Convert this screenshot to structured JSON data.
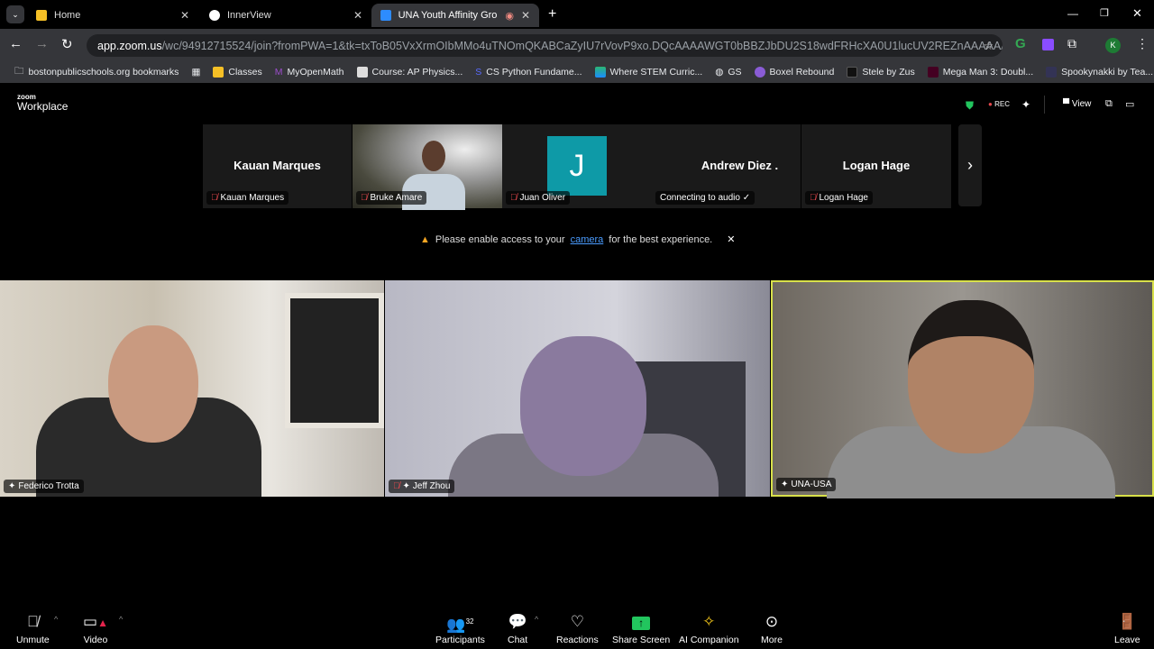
{
  "browser": {
    "tabs": [
      {
        "label": "Home",
        "active": false
      },
      {
        "label": "InnerView",
        "active": false
      },
      {
        "label": "UNA Youth Affinity Group A",
        "active": true
      }
    ],
    "url_domain": "app.zoom.us",
    "url_rest": "/wc/94912715524/join?fromPWA=1&tk=txToB05VxXrmOIbMMo4uTNOmQKABCaZyIU7rVovP9xo.DQcAAAAWGT0bBBZJbDU2S18wdFRHcXA0U1lucUV2REZnAAAAAAAAAAAAAAA...",
    "profile_initial": "K",
    "bookmarks": [
      "bostonpublicschools.org bookmarks",
      "Classes",
      "MyOpenMath",
      "Course: AP Physics...",
      "CS Python Fundame...",
      "Where STEM Curric...",
      "GS",
      "Boxel Rebound",
      "Stele by Zus",
      "Mega Man 3: Doubl...",
      "Spookynakki by Tea..."
    ]
  },
  "zoom": {
    "logo_top": "zoom",
    "logo_bottom": "Workplace",
    "rec_label": "REC",
    "view_label": "View",
    "thumbnails": [
      {
        "big": "Kauan Marques",
        "tag": "Kauan Marques",
        "muted": true,
        "video": false
      },
      {
        "big": "",
        "tag": "Bruke Amare",
        "muted": true,
        "video": true
      },
      {
        "big": "J",
        "tag": "Juan Oliver",
        "muted": true,
        "avatar_color": "#0e9aa7"
      },
      {
        "big": "Andrew Diez .",
        "tag": "Connecting to audio ✓",
        "muted": false
      },
      {
        "big": "Logan Hage",
        "tag": "Logan Hage",
        "muted": true
      }
    ],
    "notice": {
      "before": "Please enable access to your",
      "link": "camera",
      "after": "for the best experience."
    },
    "main_videos": [
      {
        "name": "Federico Trotta"
      },
      {
        "name": "Jeff Zhou"
      },
      {
        "name": "UNA-USA",
        "active_speaker": true
      }
    ],
    "controls": {
      "unmute": "Unmute",
      "video": "Video",
      "participants": "Participants",
      "participants_count": "32",
      "chat": "Chat",
      "reactions": "Reactions",
      "share": "Share Screen",
      "ai": "AI Companion",
      "more": "More",
      "leave": "Leave"
    }
  }
}
